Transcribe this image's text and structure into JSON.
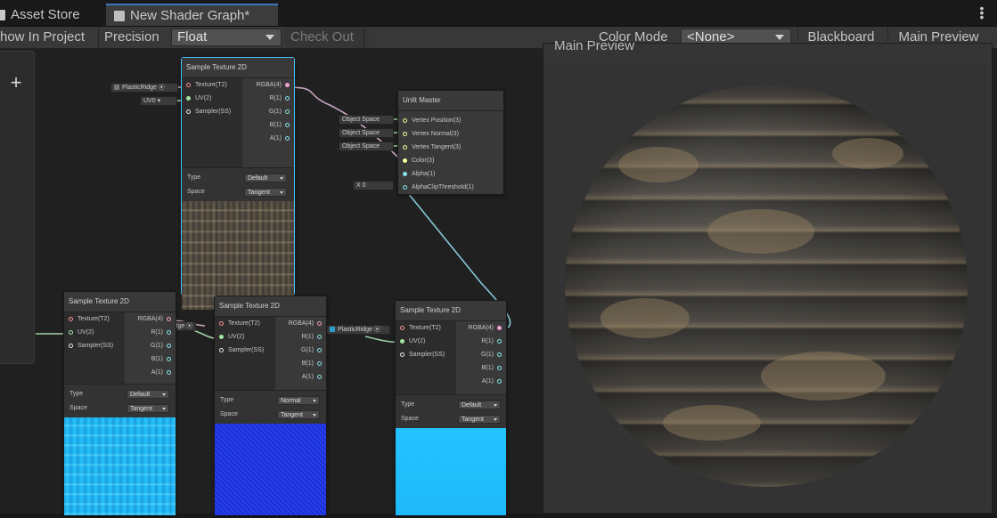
{
  "tabs": [
    {
      "label": "Asset Store",
      "icon": "lock-icon"
    },
    {
      "label": "New Shader Graph*",
      "icon": "shader-graph-icon",
      "active": true
    }
  ],
  "toolbar": {
    "show_in_project": "how In Project",
    "precision_label": "Precision",
    "precision_value": "Float",
    "check_out": "Check Out",
    "color_mode_label": "Color Mode",
    "color_mode_value": "<None>",
    "blackboard": "Blackboard",
    "main_preview": "Main Preview"
  },
  "blackboard": {
    "add": "+"
  },
  "preview": {
    "title": "Main Preview"
  },
  "nodes": {
    "sample_top": {
      "title": "Sample Texture 2D",
      "inputs": [
        "Texture(T2)",
        "UV(2)",
        "Sampler(SS)"
      ],
      "outputs": [
        "RGBA(4)",
        "R(1)",
        "G(1)",
        "B(1)",
        "A(1)"
      ],
      "type_label": "Type",
      "type_value": "Default",
      "space_label": "Space",
      "space_value": "Tangent"
    },
    "unlit_master": {
      "title": "Unlit Master",
      "inputs": [
        "Vertex Position(3)",
        "Vertex Normal(3)",
        "Vertex Tangent(3)",
        "Color(3)",
        "Alpha(1)",
        "AlphaClipThreshold(1)"
      ],
      "space_pills": [
        "Object Space",
        "Object Space",
        "Object Space"
      ],
      "alpha_clip": {
        "axis": "X",
        "value": "0"
      }
    },
    "sample_left": {
      "title": "Sample Texture 2D",
      "inputs": [
        "Texture(T2)",
        "UV(2)",
        "Sampler(SS)"
      ],
      "outputs": [
        "RGBA(4)",
        "R(1)",
        "G(1)",
        "B(1)",
        "A(1)"
      ],
      "type_label": "Type",
      "type_value": "Default",
      "space_label": "Space",
      "space_value": "Tangent"
    },
    "sample_mid": {
      "title": "Sample Texture 2D",
      "inputs": [
        "Texture(T2)",
        "UV(2)",
        "Sampler(SS)"
      ],
      "outputs": [
        "RGBA(4)",
        "R(1)",
        "G(1)",
        "B(1)",
        "A(1)"
      ],
      "type_label": "Type",
      "type_value": "Normal",
      "space_label": "Space",
      "space_value": "Tangent"
    },
    "sample_right": {
      "title": "Sample Texture 2D",
      "inputs": [
        "Texture(T2)",
        "UV(2)",
        "Sampler(SS)"
      ],
      "outputs": [
        "RGBA(4)",
        "R(1)",
        "G(1)",
        "B(1)",
        "A(1)"
      ],
      "type_label": "Type",
      "type_value": "Default",
      "space_label": "Space",
      "space_value": "Tangent"
    }
  },
  "pills": {
    "plastic_top": "PlasticRidge",
    "uv0": "UV0",
    "ridge_mid": "idge",
    "plastic_right": "PlasticRidge"
  },
  "colors": {
    "selection": "#44c0ff",
    "wire_color": "#c9a9c4",
    "wire_vector": "#9fd0a0",
    "wire_alpha": "#86c9d8",
    "port_texture": "#f29191",
    "port_uv": "#a3e6a3",
    "port_sampler": "#e6e6e6",
    "port_rgba": "#f2a0d0",
    "port_float": "#84e4e7",
    "port_vec3": "#f6ff9a"
  }
}
